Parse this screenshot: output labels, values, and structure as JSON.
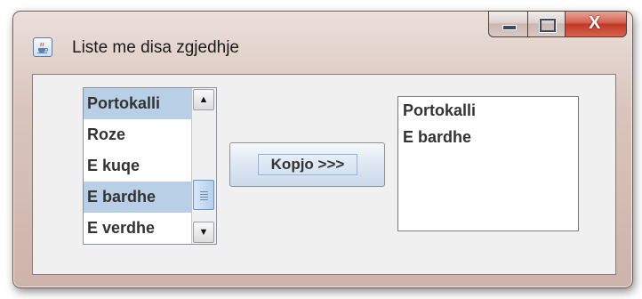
{
  "window": {
    "title": "Liste me disa zgjedhje",
    "icon": "java-cup-icon",
    "controls": {
      "minimize": "minimize-icon",
      "maximize": "maximize-icon",
      "close_glyph": "X"
    }
  },
  "source_list": {
    "items": [
      {
        "label": "Portokalli",
        "selected": true
      },
      {
        "label": "Roze",
        "selected": false
      },
      {
        "label": "E kuqe",
        "selected": false
      },
      {
        "label": "E bardhe",
        "selected": true
      },
      {
        "label": "E verdhe",
        "selected": false
      }
    ],
    "scroll_up_glyph": "▲",
    "scroll_down_glyph": "▼"
  },
  "copy_button": {
    "label": "Kopjo >>>"
  },
  "target_list": {
    "items": [
      "Portokalli",
      "E bardhe"
    ]
  },
  "colors": {
    "selection": "#b8cfe5",
    "close_button": "#c03a26"
  }
}
